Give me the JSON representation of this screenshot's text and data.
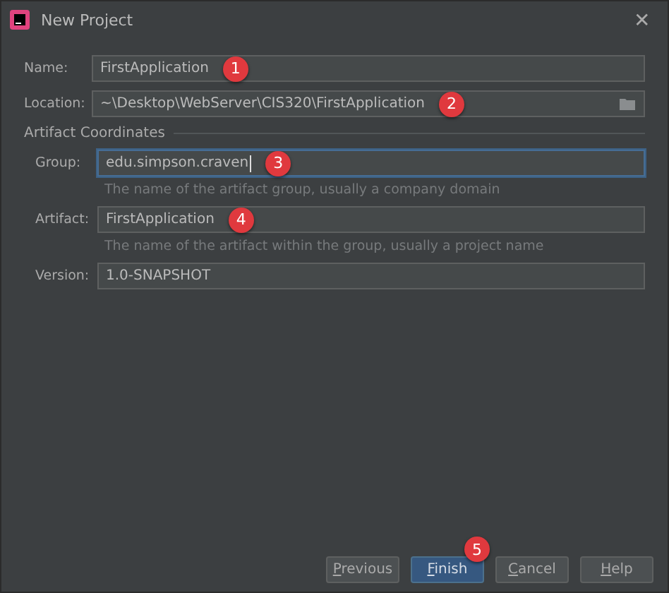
{
  "window": {
    "title": "New Project",
    "close": "✕"
  },
  "fields": [
    {
      "label": "Name:",
      "value": "FirstApplication",
      "badge": "1",
      "focused": false,
      "browse": false
    },
    {
      "label": "Location:",
      "value": "~\\Desktop\\WebServer\\CIS320\\FirstApplication",
      "badge": "2",
      "focused": false,
      "browse": true
    }
  ],
  "artifact_coordinates": {
    "title": "Artifact Coordinates",
    "fields": [
      {
        "label": "Group:",
        "value": "edu.simpson.craven",
        "badge": "3",
        "focused": true,
        "hint": "The name of the artifact group, usually a company domain"
      },
      {
        "label": "Artifact:",
        "value": "FirstApplication",
        "badge": "4",
        "focused": false,
        "hint": "The name of the artifact within the group, usually a project name"
      },
      {
        "label": "Version:",
        "value": "1.0-SNAPSHOT",
        "focused": false
      }
    ]
  },
  "buttons": [
    {
      "label": "Previous",
      "default": false
    },
    {
      "label": "Finish",
      "default": true,
      "badge": "5"
    },
    {
      "label": "Cancel",
      "default": false
    },
    {
      "label": "Help",
      "default": false
    }
  ]
}
